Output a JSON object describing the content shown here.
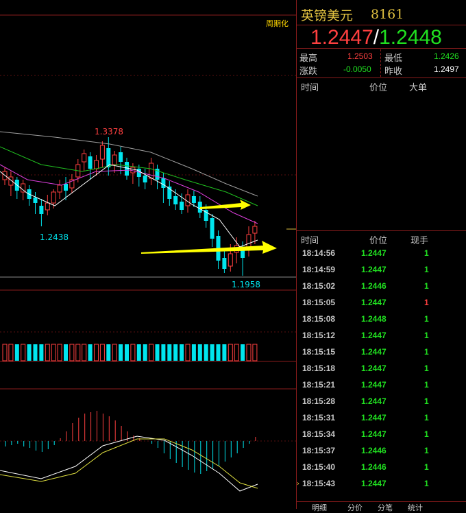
{
  "chart": {
    "period_button": "周期化",
    "high_label": "1.3378",
    "low_label_left": "1.2438",
    "low_label_bottom": "1.1958"
  },
  "quote": {
    "name": "英镑美元",
    "code": "8161",
    "bid": "1.2447",
    "separator": "/",
    "ask": "1.2448",
    "high_label": "最高",
    "high": "1.2503",
    "low_label": "最低",
    "low": "1.2426",
    "change_label": "涨跌",
    "change": "-0.0050",
    "prev_close_label": "昨收",
    "prev_close": "1.2497"
  },
  "big_orders": {
    "headers": [
      "时间",
      "价位",
      "大单"
    ]
  },
  "ticks": {
    "headers": [
      "时间",
      "价位",
      "现手"
    ],
    "rows": [
      {
        "time": "18:14:56",
        "price": "1.2447",
        "vol": "1",
        "color": "green"
      },
      {
        "time": "18:14:59",
        "price": "1.2447",
        "vol": "1",
        "color": "green"
      },
      {
        "time": "18:15:02",
        "price": "1.2446",
        "vol": "1",
        "color": "green"
      },
      {
        "time": "18:15:05",
        "price": "1.2447",
        "vol": "1",
        "color": "red"
      },
      {
        "time": "18:15:08",
        "price": "1.2448",
        "vol": "1",
        "color": "green"
      },
      {
        "time": "18:15:12",
        "price": "1.2447",
        "vol": "1",
        "color": "green"
      },
      {
        "time": "18:15:15",
        "price": "1.2447",
        "vol": "1",
        "color": "green"
      },
      {
        "time": "18:15:18",
        "price": "1.2447",
        "vol": "1",
        "color": "green"
      },
      {
        "time": "18:15:21",
        "price": "1.2447",
        "vol": "1",
        "color": "green"
      },
      {
        "time": "18:15:28",
        "price": "1.2447",
        "vol": "1",
        "color": "green"
      },
      {
        "time": "18:15:31",
        "price": "1.2447",
        "vol": "1",
        "color": "green"
      },
      {
        "time": "18:15:34",
        "price": "1.2447",
        "vol": "1",
        "color": "green"
      },
      {
        "time": "18:15:37",
        "price": "1.2446",
        "vol": "1",
        "color": "green"
      },
      {
        "time": "18:15:40",
        "price": "1.2446",
        "vol": "1",
        "color": "green"
      },
      {
        "time": "18:15:43",
        "price": "1.2447",
        "vol": "1",
        "color": "green"
      }
    ]
  },
  "tabs": [
    "明细",
    "分价",
    "分笔",
    "统计"
  ],
  "colors": {
    "up": "#ff4040",
    "down": "#00e5ee",
    "accent": "#e0c040",
    "grid": "#8a1c1c"
  }
}
